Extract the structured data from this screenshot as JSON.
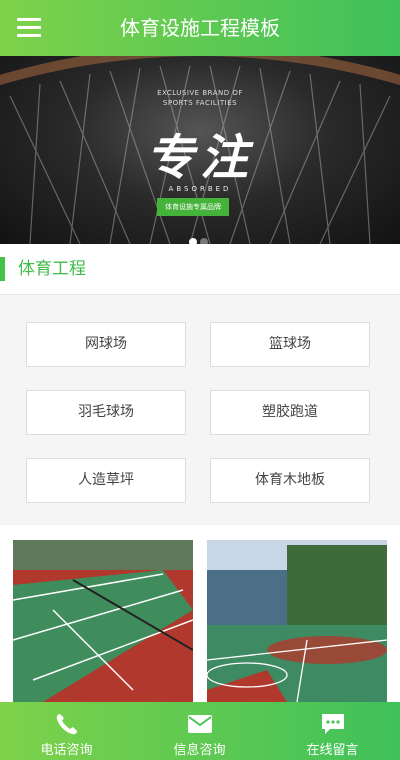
{
  "header": {
    "title": "体育设施工程模板",
    "menu_icon": "hamburger-menu-icon"
  },
  "banner": {
    "english_line1": "EXCLUSIVE BRAND OF",
    "english_line2": "SPORTS FACILITIES",
    "headline": "专注",
    "subline": "ABSORBED",
    "tag": "体育设施专属品牌",
    "slides_total": 2,
    "active_slide": 1
  },
  "section": {
    "title": "体育工程",
    "accent": "#45c24a"
  },
  "categories": [
    {
      "label": "网球场"
    },
    {
      "label": "篮球场"
    },
    {
      "label": "羽毛球场"
    },
    {
      "label": "塑胶跑道"
    },
    {
      "label": "人造草坪"
    },
    {
      "label": "体育木地板"
    }
  ],
  "photos": [
    {
      "subject": "tennis court"
    },
    {
      "subject": "basketball court"
    }
  ],
  "footer": {
    "items": [
      {
        "label": "电话咨询",
        "icon": "phone-icon"
      },
      {
        "label": "信息咨询",
        "icon": "mail-icon"
      },
      {
        "label": "在线留言",
        "icon": "message-icon"
      }
    ]
  },
  "colors": {
    "brand_green_start": "#7ed24a",
    "brand_green_end": "#3fc15a"
  }
}
